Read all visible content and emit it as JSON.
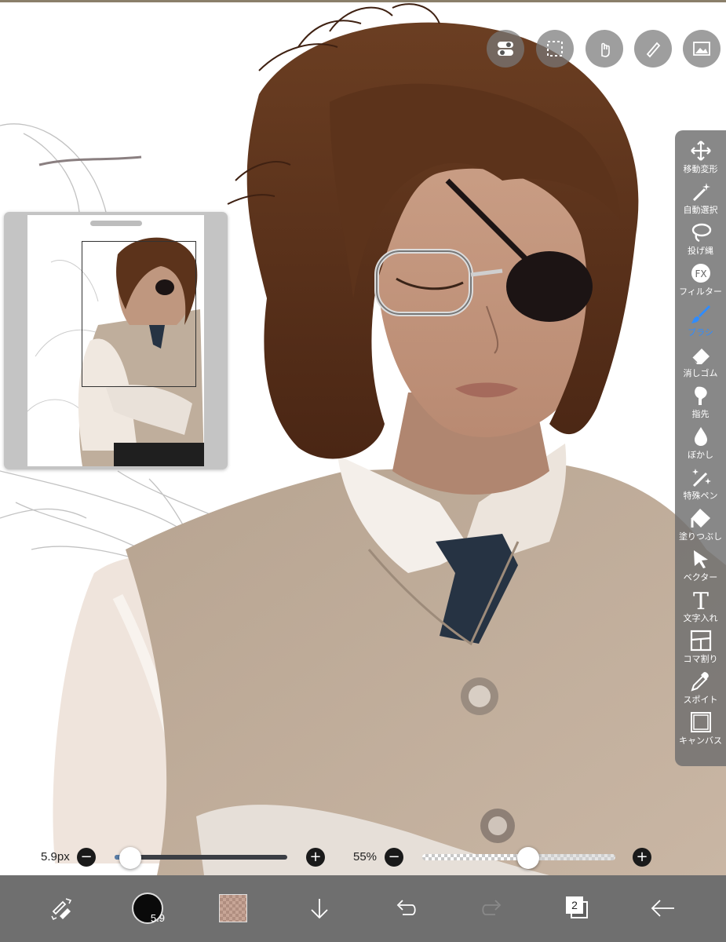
{
  "top_buttons": [
    {
      "icon": "toggle-switch-icon"
    },
    {
      "icon": "selection-marquee-icon"
    },
    {
      "icon": "hand-touch-icon"
    },
    {
      "icon": "pen-ruler-icon"
    },
    {
      "icon": "image-icon"
    }
  ],
  "tool_palette": {
    "items": [
      {
        "label": "移動変形",
        "icon": "move-transform-icon",
        "active": false
      },
      {
        "label": "自動選択",
        "icon": "magic-wand-icon",
        "active": false
      },
      {
        "label": "投げ縄",
        "icon": "lasso-icon",
        "active": false
      },
      {
        "label": "フィルター",
        "icon": "fx-filter-icon",
        "active": false
      },
      {
        "label": "ブラシ",
        "icon": "brush-icon",
        "active": true
      },
      {
        "label": "消しゴム",
        "icon": "eraser-icon",
        "active": false
      },
      {
        "label": "指先",
        "icon": "finger-smudge-icon",
        "active": false
      },
      {
        "label": "ぼかし",
        "icon": "blur-drop-icon",
        "active": false
      },
      {
        "label": "特殊ペン",
        "icon": "special-pen-icon",
        "active": false
      },
      {
        "label": "塗りつぶし",
        "icon": "fill-bucket-icon",
        "active": false
      },
      {
        "label": "ベクター",
        "icon": "vector-arrow-icon",
        "active": false
      },
      {
        "label": "文字入れ",
        "icon": "text-icon",
        "active": false
      },
      {
        "label": "コマ割り",
        "icon": "frame-divider-icon",
        "active": false
      },
      {
        "label": "スポイト",
        "icon": "eyedropper-icon",
        "active": false
      },
      {
        "label": "キャンバス",
        "icon": "canvas-icon",
        "active": false
      }
    ],
    "active_color": "#2f8cff"
  },
  "sliders": {
    "brush_size": {
      "value_text": "5.9px",
      "minus": "−",
      "plus": "+",
      "level": 0.09
    },
    "opacity": {
      "value_text": "55%",
      "minus": "−",
      "plus": "+",
      "level": 0.55
    }
  },
  "bottom_bar": {
    "brush_size_badge": "5.9",
    "layer_count": "2",
    "items": [
      "pen-eraser-swap-icon",
      "brush-size-indicator",
      "color-swatch",
      "download-arrow-icon",
      "undo-icon",
      "redo-icon",
      "layers-icon",
      "back-arrow-icon"
    ]
  }
}
